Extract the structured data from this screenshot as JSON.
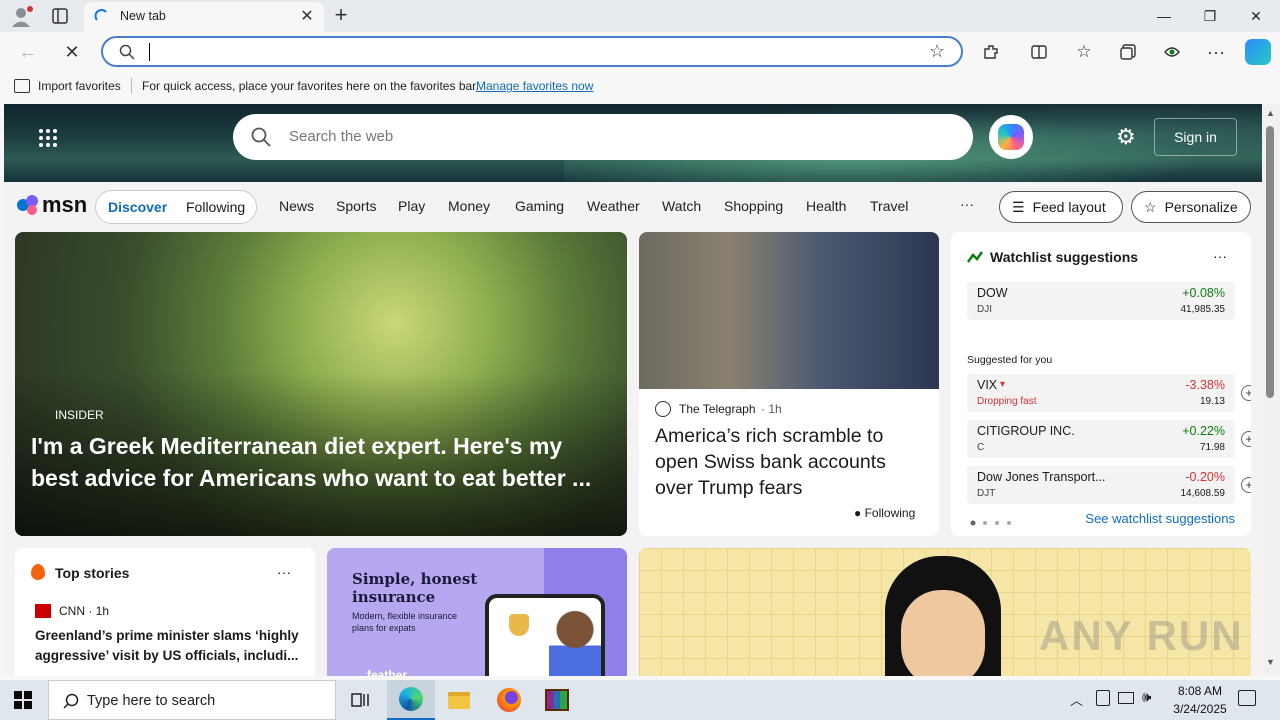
{
  "browser": {
    "tab_title": "New tab",
    "new_tab_symbol": "+",
    "address_value": "",
    "favorites": {
      "import_label": "Import favorites",
      "hint_text": "For quick access, place your favorites here on the favorites bar.",
      "manage_link": "Manage favorites now"
    }
  },
  "msn": {
    "search_placeholder": "Search the web",
    "signin_label": "Sign in",
    "logo_text": "msn",
    "segments": [
      "Discover",
      "Following"
    ],
    "nav": [
      "News",
      "Sports",
      "Play",
      "Money",
      "Gaming",
      "Weather",
      "Watch",
      "Shopping",
      "Health",
      "Travel"
    ],
    "more_label": "···",
    "feed_layout_label": "Feed layout",
    "personalize_label": "Personalize"
  },
  "hero_card": {
    "source": "INSIDER",
    "headline": "I'm a Greek Mediterranean diet expert. Here's my best advice for Americans who want to eat better ..."
  },
  "news_card": {
    "source": "The Telegraph",
    "time": "· 1h",
    "headline": "America’s rich scramble to open Swiss bank accounts over Trump fears",
    "following_label": "Following"
  },
  "watchlist": {
    "title": "Watchlist suggestions",
    "more": "···",
    "suggested_label": "Suggested for you",
    "see_more": "See watchlist suggestions",
    "stocks": [
      {
        "name": "DOW",
        "symbol": "DJI",
        "change": "+0.08%",
        "price": "41,985.35",
        "trend": "up"
      },
      {
        "name": "VIX",
        "symbol": "Dropping fast",
        "change": "-3.38%",
        "price": "19.13",
        "trend": "down"
      },
      {
        "name": "CITIGROUP INC.",
        "symbol": "C",
        "change": "+0.22%",
        "price": "71.98",
        "trend": "up"
      },
      {
        "name": "Dow Jones Transport...",
        "symbol": "DJT",
        "change": "-0.20%",
        "price": "14,608.59",
        "trend": "down"
      }
    ]
  },
  "top_stories": {
    "title": "Top stories",
    "more": "···",
    "source": "CNN · 1h",
    "headline": "Greenland’s prime minister slams ‘highly aggressive’ visit by US officials, includi..."
  },
  "ad_card": {
    "headline": "Simple, honest insurance",
    "subtext": "Modern, flexible insurance plans for expats",
    "brand": "feather"
  },
  "watermark": "ANY RUN",
  "taskbar": {
    "search_placeholder": "Type here to search",
    "time": "8:08 AM",
    "date": "3/24/2025"
  },
  "colors": {
    "accent": "#0f6cbd",
    "up": "#107c10",
    "down": "#d13438",
    "taskbar": "#dfe6ee"
  }
}
